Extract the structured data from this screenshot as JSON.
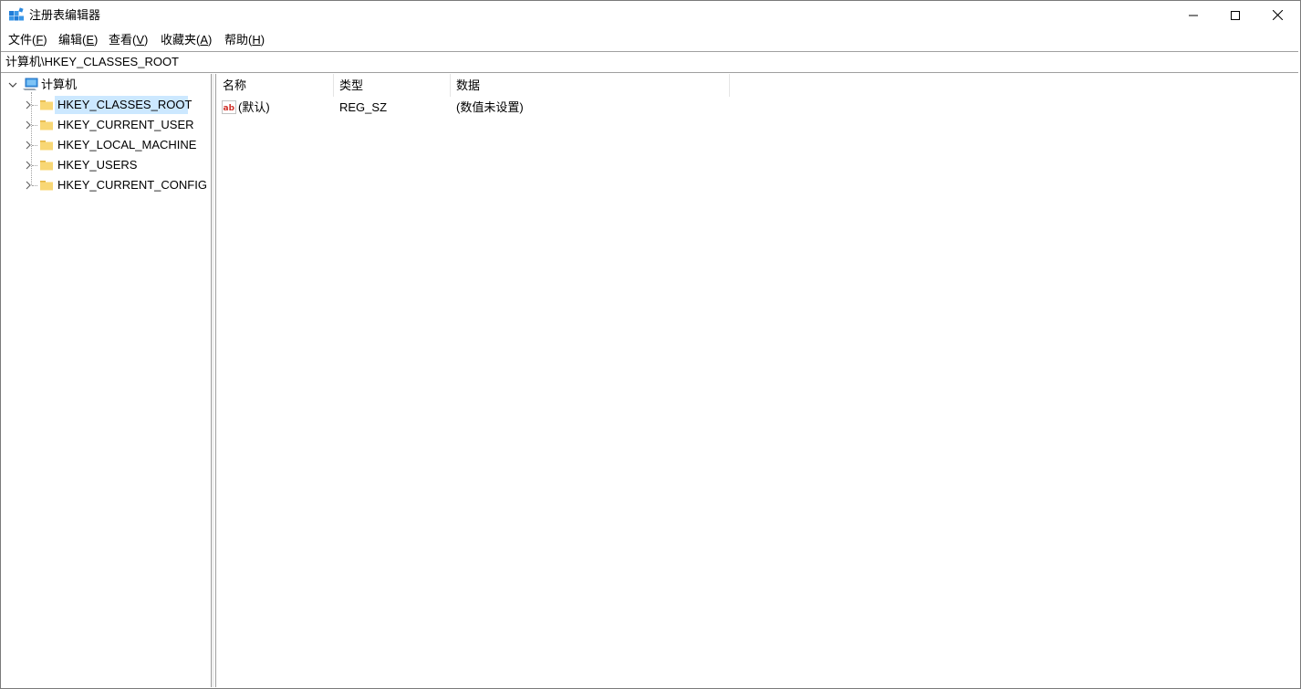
{
  "window": {
    "title": "注册表编辑器",
    "minimize_glyph": "—",
    "maximize_glyph": "☐",
    "close_glyph": "✕"
  },
  "menu": [
    {
      "label": "文件(",
      "accel": "F",
      "tail": ")"
    },
    {
      "label": "编辑(",
      "accel": "E",
      "tail": ")"
    },
    {
      "label": "查看(",
      "accel": "V",
      "tail": ")"
    },
    {
      "label": "收藏夹(",
      "accel": "A",
      "tail": ")"
    },
    {
      "label": "帮助(",
      "accel": "H",
      "tail": ")"
    }
  ],
  "address": "计算机\\HKEY_CLASSES_ROOT",
  "tree": {
    "root": {
      "label": "计算机",
      "icon": "computer-icon",
      "expanded": true
    },
    "keys": [
      {
        "label": "HKEY_CLASSES_ROOT",
        "selected": true
      },
      {
        "label": "HKEY_CURRENT_USER",
        "selected": false
      },
      {
        "label": "HKEY_LOCAL_MACHINE",
        "selected": false
      },
      {
        "label": "HKEY_USERS",
        "selected": false
      },
      {
        "label": "HKEY_CURRENT_CONFIG",
        "selected": false
      }
    ]
  },
  "list": {
    "columns": [
      "名称",
      "类型",
      "数据"
    ],
    "rows": [
      {
        "name": "(默认)",
        "type": "REG_SZ",
        "data": "(数值未设置)",
        "icon": "string-value-icon"
      }
    ]
  },
  "colors": {
    "selection": "#cce8ff",
    "folder": "#f8d775",
    "folder_dark": "#e3b543",
    "border": "#a0a0a0"
  }
}
